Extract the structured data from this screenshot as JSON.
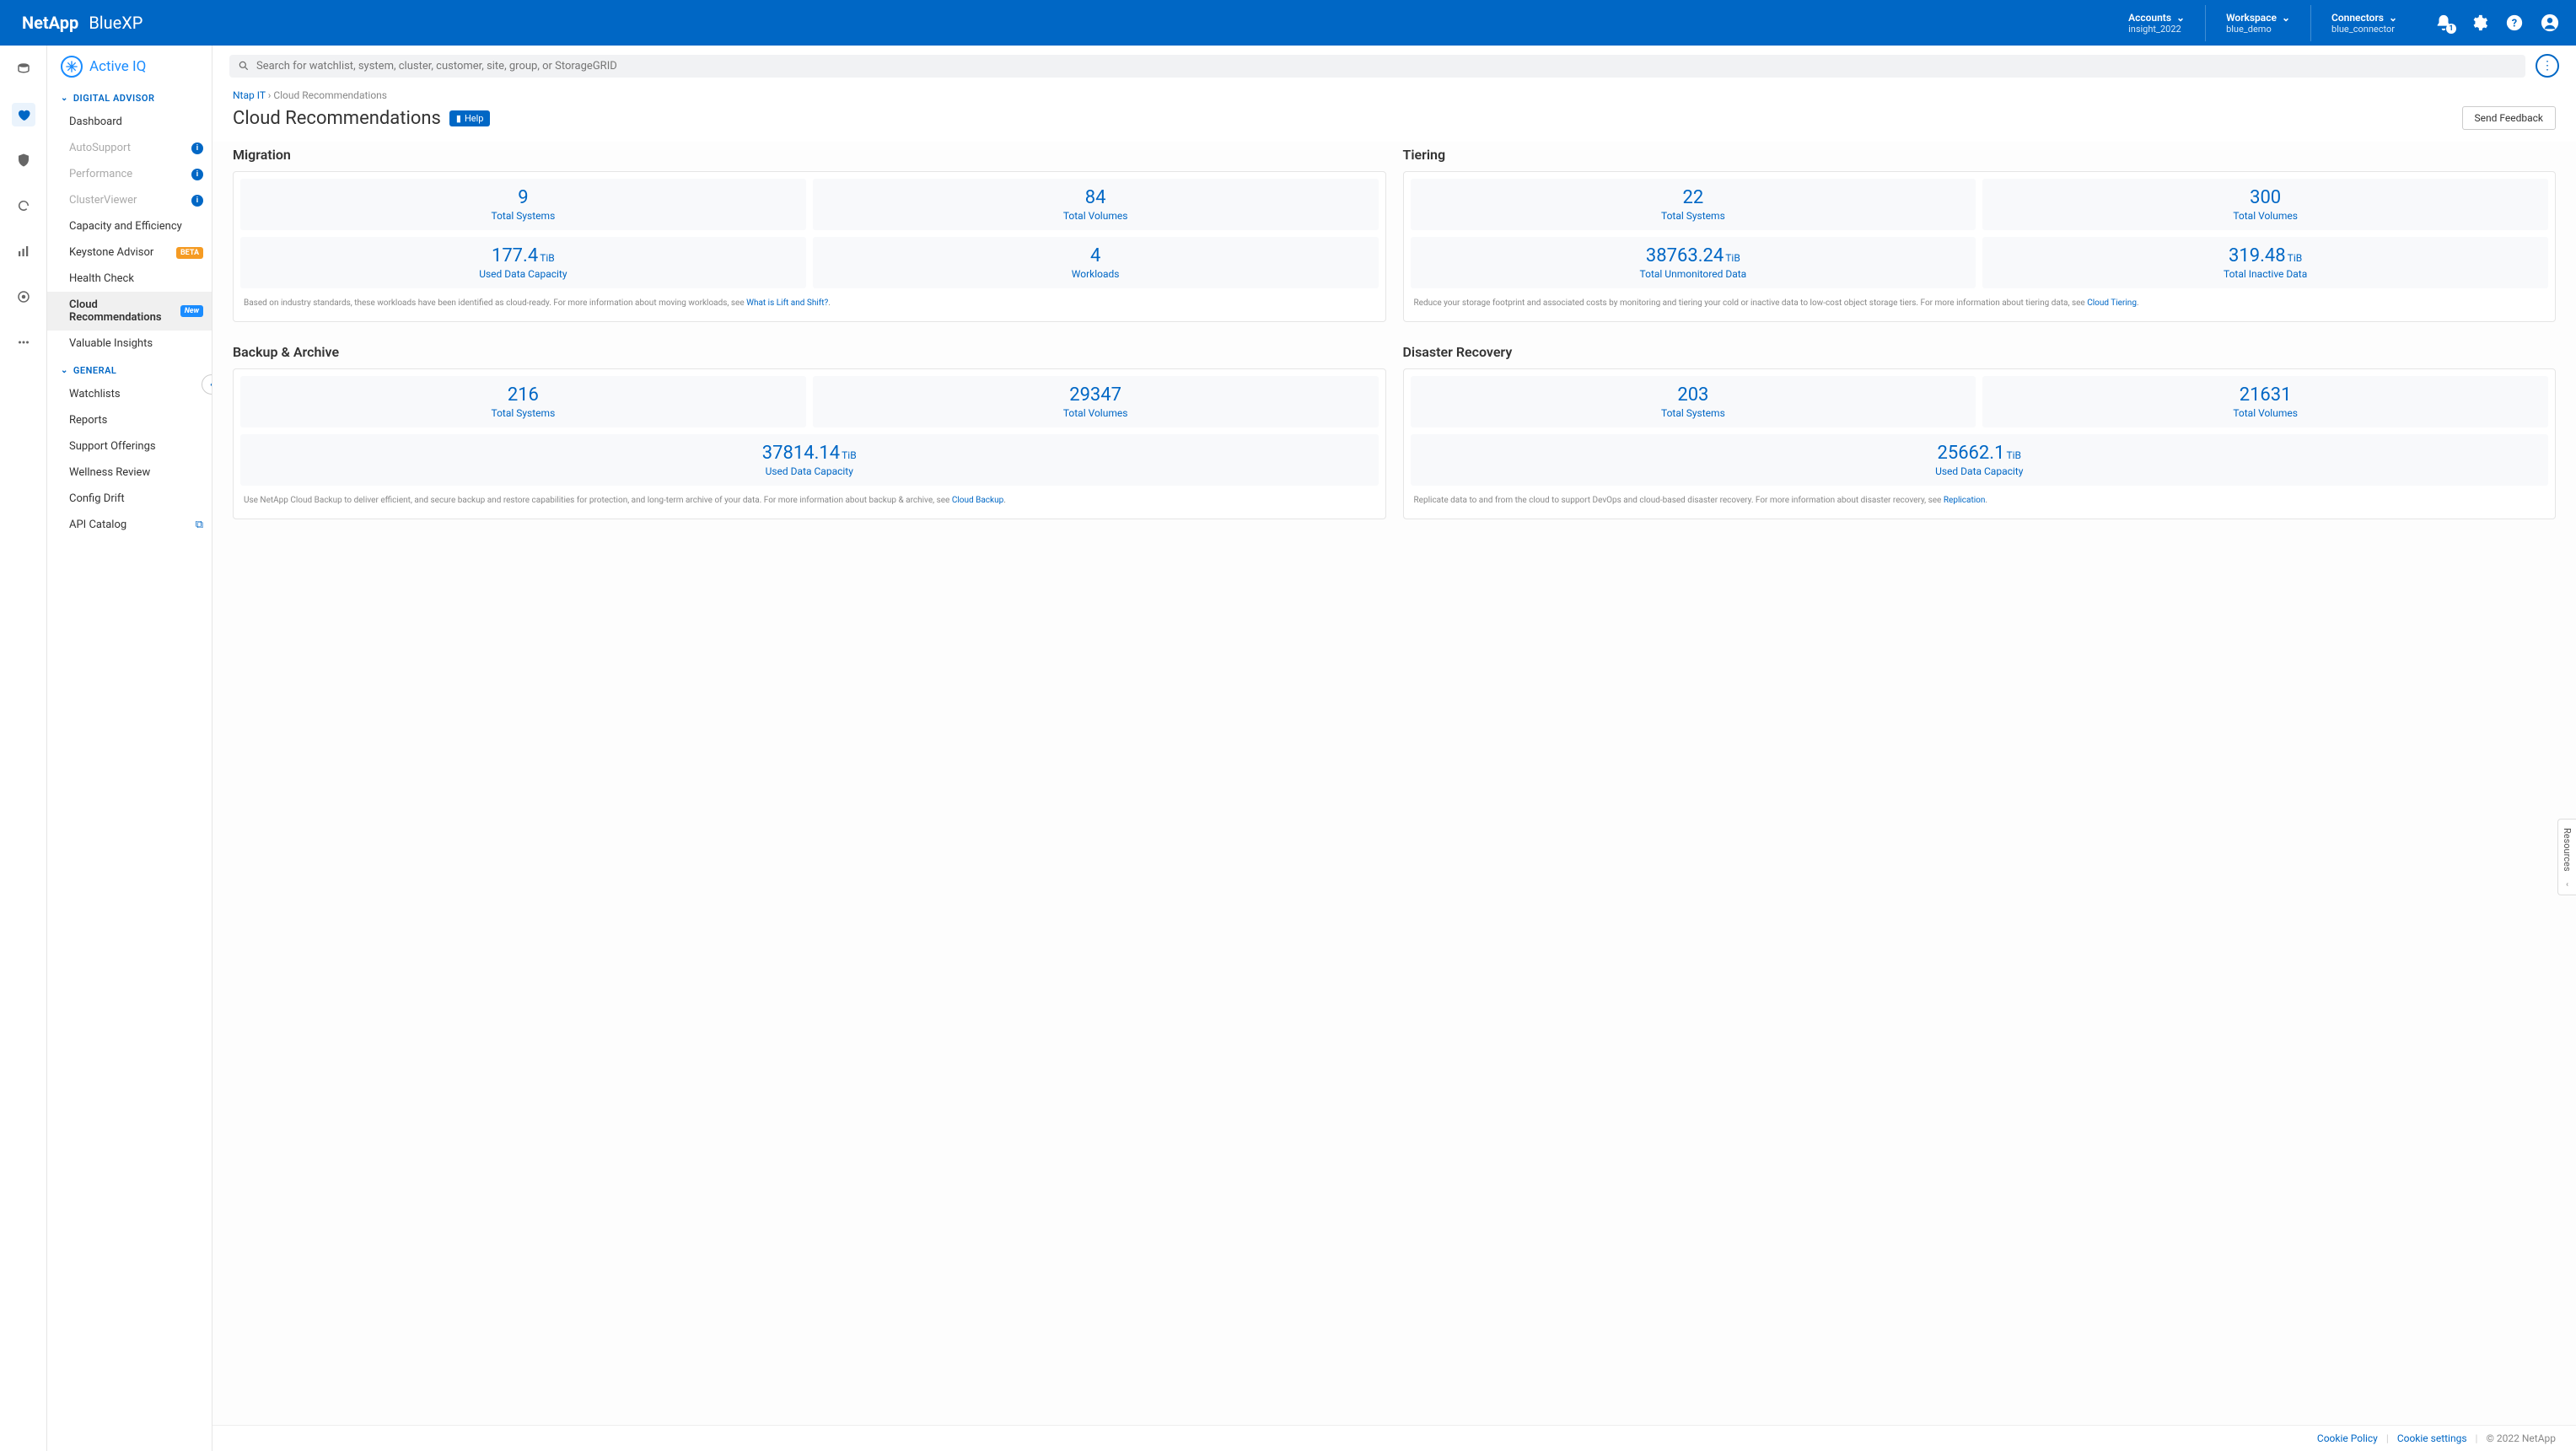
{
  "header": {
    "brand_vendor": "NetApp",
    "brand_product": "BlueXP",
    "accounts_label": "Accounts",
    "accounts_value": "insight_2022",
    "workspace_label": "Workspace",
    "workspace_value": "blue_demo",
    "connectors_label": "Connectors",
    "connectors_value": "blue_connector",
    "notif_count": "1"
  },
  "sidebar": {
    "brand": "Active IQ",
    "sections": {
      "digital_advisor": {
        "label": "DIGITAL ADVISOR",
        "items": [
          {
            "label": "Dashboard"
          },
          {
            "label": "AutoSupport",
            "info": "i"
          },
          {
            "label": "Performance",
            "info": "i"
          },
          {
            "label": "ClusterViewer",
            "info": "i"
          },
          {
            "label": "Capacity and Efficiency"
          },
          {
            "label": "Keystone Advisor",
            "pill": "BETA"
          },
          {
            "label": "Health Check"
          },
          {
            "label": "Cloud Recommendations",
            "pill": "New"
          },
          {
            "label": "Valuable Insights"
          }
        ]
      },
      "general": {
        "label": "GENERAL",
        "items": [
          {
            "label": "Watchlists"
          },
          {
            "label": "Reports"
          },
          {
            "label": "Support Offerings"
          },
          {
            "label": "Wellness Review"
          },
          {
            "label": "Config Drift"
          },
          {
            "label": "API Catalog",
            "ext": true
          }
        ]
      }
    }
  },
  "search": {
    "placeholder": "Search for watchlist, system, cluster, customer, site, group, or StorageGRID"
  },
  "breadcrumb": {
    "root": "Ntap IT",
    "current": "Cloud Recommendations"
  },
  "page": {
    "title": "Cloud Recommendations",
    "help": "Help",
    "feedback": "Send Feedback"
  },
  "panels": {
    "migration": {
      "title": "Migration",
      "stats": [
        {
          "value": "9",
          "unit": "",
          "label": "Total Systems"
        },
        {
          "value": "84",
          "unit": "",
          "label": "Total Volumes"
        },
        {
          "value": "177.4",
          "unit": "TiB",
          "label": "Used Data Capacity"
        },
        {
          "value": "4",
          "unit": "",
          "label": "Workloads"
        }
      ],
      "note_pre": "Based on industry standards, these workloads have been identified as cloud-ready. For more information about moving workloads, see ",
      "note_link": "What is Lift and Shift?",
      "note_post": "."
    },
    "tiering": {
      "title": "Tiering",
      "stats": [
        {
          "value": "22",
          "unit": "",
          "label": "Total Systems"
        },
        {
          "value": "300",
          "unit": "",
          "label": "Total Volumes"
        },
        {
          "value": "38763.24",
          "unit": "TiB",
          "label": "Total Unmonitored Data"
        },
        {
          "value": "319.48",
          "unit": "TiB",
          "label": "Total Inactive Data"
        }
      ],
      "note_pre": "Reduce your storage footprint and associated costs by monitoring and tiering your cold or inactive data to low-cost object storage tiers. For more information about tiering data, see ",
      "note_link": "Cloud Tiering",
      "note_post": "."
    },
    "backup": {
      "title": "Backup & Archive",
      "stats": [
        {
          "value": "216",
          "unit": "",
          "label": "Total Systems"
        },
        {
          "value": "29347",
          "unit": "",
          "label": "Total Volumes"
        }
      ],
      "wide_stat": {
        "value": "37814.14",
        "unit": "TiB",
        "label": "Used Data Capacity"
      },
      "note_pre": "Use NetApp Cloud Backup to deliver efficient, and secure backup and restore capabilities for protection, and long-term archive of your data. For more information about backup & archive, see ",
      "note_link": "Cloud Backup",
      "note_post": "."
    },
    "dr": {
      "title": "Disaster Recovery",
      "stats": [
        {
          "value": "203",
          "unit": "",
          "label": "Total Systems"
        },
        {
          "value": "21631",
          "unit": "",
          "label": "Total Volumes"
        }
      ],
      "wide_stat": {
        "value": "25662.1",
        "unit": "TiB",
        "label": "Used Data Capacity"
      },
      "note_pre": "Replicate data to and from the cloud to support DevOps and cloud-based disaster recovery. For more information about disaster recovery, see ",
      "note_link": "Replication",
      "note_post": "."
    }
  },
  "resources_tab": "Resources",
  "footer": {
    "cookie_policy": "Cookie Policy",
    "cookie_settings": "Cookie settings",
    "copyright": "© 2022 NetApp"
  }
}
